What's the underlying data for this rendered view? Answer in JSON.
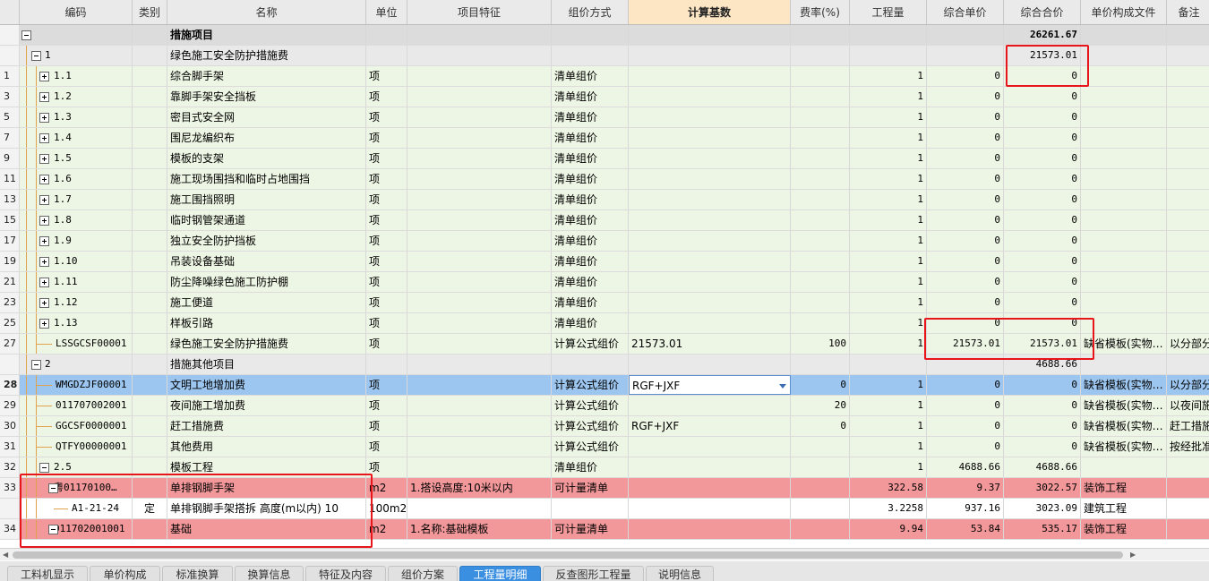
{
  "columns": [
    "",
    "编码",
    "类别",
    "名称",
    "单位",
    "项目特征",
    "组价方式",
    "计算基数",
    "费率(%)",
    "工程量",
    "综合单价",
    "综合合价",
    "单价构成文件",
    "备注"
  ],
  "rows": [
    {
      "kind": "sec",
      "row": "",
      "code": "",
      "type": "",
      "name": "措施项目",
      "unit": "",
      "feature": "",
      "method": "",
      "base": "",
      "rate": "",
      "qty": "",
      "price": "",
      "total": "26261.67",
      "file": "",
      "note": ""
    },
    {
      "kind": "sub",
      "row": "",
      "code": "1",
      "type": "",
      "name": "绿色施工安全防护措施费",
      "unit": "",
      "feature": "",
      "method": "",
      "base": "",
      "rate": "",
      "qty": "",
      "price": "",
      "total": "21573.01",
      "file": "",
      "note": ""
    },
    {
      "kind": "grn",
      "row": "1",
      "code": "1.1",
      "type": "",
      "name": "综合脚手架",
      "unit": "项",
      "feature": "",
      "method": "清单组价",
      "base": "",
      "rate": "",
      "qty": "1",
      "price": "0",
      "total": "0",
      "file": "",
      "note": ""
    },
    {
      "kind": "grn",
      "row": "3",
      "code": "1.2",
      "type": "",
      "name": "靠脚手架安全挡板",
      "unit": "项",
      "feature": "",
      "method": "清单组价",
      "base": "",
      "rate": "",
      "qty": "1",
      "price": "0",
      "total": "0",
      "file": "",
      "note": ""
    },
    {
      "kind": "grn",
      "row": "5",
      "code": "1.3",
      "type": "",
      "name": "密目式安全网",
      "unit": "项",
      "feature": "",
      "method": "清单组价",
      "base": "",
      "rate": "",
      "qty": "1",
      "price": "0",
      "total": "0",
      "file": "",
      "note": ""
    },
    {
      "kind": "grn",
      "row": "7",
      "code": "1.4",
      "type": "",
      "name": "围尼龙编织布",
      "unit": "项",
      "feature": "",
      "method": "清单组价",
      "base": "",
      "rate": "",
      "qty": "1",
      "price": "0",
      "total": "0",
      "file": "",
      "note": ""
    },
    {
      "kind": "grn",
      "row": "9",
      "code": "1.5",
      "type": "",
      "name": "模板的支架",
      "unit": "项",
      "feature": "",
      "method": "清单组价",
      "base": "",
      "rate": "",
      "qty": "1",
      "price": "0",
      "total": "0",
      "file": "",
      "note": ""
    },
    {
      "kind": "grn",
      "row": "11",
      "code": "1.6",
      "type": "",
      "name": "施工现场围挡和临时占地围挡",
      "unit": "项",
      "feature": "",
      "method": "清单组价",
      "base": "",
      "rate": "",
      "qty": "1",
      "price": "0",
      "total": "0",
      "file": "",
      "note": ""
    },
    {
      "kind": "grn",
      "row": "13",
      "code": "1.7",
      "type": "",
      "name": "施工围挡照明",
      "unit": "项",
      "feature": "",
      "method": "清单组价",
      "base": "",
      "rate": "",
      "qty": "1",
      "price": "0",
      "total": "0",
      "file": "",
      "note": ""
    },
    {
      "kind": "grn",
      "row": "15",
      "code": "1.8",
      "type": "",
      "name": "临时钢管架通道",
      "unit": "项",
      "feature": "",
      "method": "清单组价",
      "base": "",
      "rate": "",
      "qty": "1",
      "price": "0",
      "total": "0",
      "file": "",
      "note": ""
    },
    {
      "kind": "grn",
      "row": "17",
      "code": "1.9",
      "type": "",
      "name": "独立安全防护挡板",
      "unit": "项",
      "feature": "",
      "method": "清单组价",
      "base": "",
      "rate": "",
      "qty": "1",
      "price": "0",
      "total": "0",
      "file": "",
      "note": ""
    },
    {
      "kind": "grn",
      "row": "19",
      "code": "1.10",
      "type": "",
      "name": "吊装设备基础",
      "unit": "项",
      "feature": "",
      "method": "清单组价",
      "base": "",
      "rate": "",
      "qty": "1",
      "price": "0",
      "total": "0",
      "file": "",
      "note": ""
    },
    {
      "kind": "grn",
      "row": "21",
      "code": "1.11",
      "type": "",
      "name": "防尘降噪绿色施工防护棚",
      "unit": "项",
      "feature": "",
      "method": "清单组价",
      "base": "",
      "rate": "",
      "qty": "1",
      "price": "0",
      "total": "0",
      "file": "",
      "note": ""
    },
    {
      "kind": "grn",
      "row": "23",
      "code": "1.12",
      "type": "",
      "name": "施工便道",
      "unit": "项",
      "feature": "",
      "method": "清单组价",
      "base": "",
      "rate": "",
      "qty": "1",
      "price": "0",
      "total": "0",
      "file": "",
      "note": ""
    },
    {
      "kind": "grn",
      "row": "25",
      "code": "1.13",
      "type": "",
      "name": "样板引路",
      "unit": "项",
      "feature": "",
      "method": "清单组价",
      "base": "",
      "rate": "",
      "qty": "1",
      "price": "0",
      "total": "0",
      "file": "",
      "note": ""
    },
    {
      "kind": "grn",
      "row": "27",
      "code": "LSSGCSF00001",
      "type": "",
      "name": "绿色施工安全防护措施费",
      "unit": "项",
      "feature": "",
      "method": "计算公式组价",
      "base": "21573.01",
      "rate": "100",
      "qty": "1",
      "price": "21573.01",
      "total": "21573.01",
      "file": "缺省模板(实物…",
      "note": "以分部分"
    },
    {
      "kind": "sub",
      "row": "",
      "code": "2",
      "type": "",
      "name": "措施其他项目",
      "unit": "",
      "feature": "",
      "method": "",
      "base": "",
      "rate": "",
      "qty": "",
      "price": "",
      "total": "4688.66",
      "file": "",
      "note": ""
    },
    {
      "kind": "sel",
      "row": "28",
      "code": "WMGDZJF00001",
      "type": "",
      "name": "文明工地增加费",
      "unit": "项",
      "feature": "",
      "method": "计算公式组价",
      "base": "RGF+JXF",
      "rate": "0",
      "qty": "1",
      "price": "0",
      "total": "0",
      "file": "缺省模板(实物…",
      "note": "以分部分"
    },
    {
      "kind": "grn",
      "row": "29",
      "code": "011707002001",
      "type": "",
      "name": "夜间施工增加费",
      "unit": "项",
      "feature": "",
      "method": "计算公式组价",
      "base": "",
      "rate": "20",
      "qty": "1",
      "price": "0",
      "total": "0",
      "file": "缺省模板(实物…",
      "note": "以夜间施"
    },
    {
      "kind": "grn",
      "row": "30",
      "code": "GGCSF0000001",
      "type": "",
      "name": "赶工措施费",
      "unit": "项",
      "feature": "",
      "method": "计算公式组价",
      "base": "RGF+JXF",
      "rate": "0",
      "qty": "1",
      "price": "0",
      "total": "0",
      "file": "缺省模板(实物…",
      "note": "赶工措施"
    },
    {
      "kind": "grn",
      "row": "31",
      "code": "QTFY00000001",
      "type": "",
      "name": "其他费用",
      "unit": "项",
      "feature": "",
      "method": "计算公式组价",
      "base": "",
      "rate": "",
      "qty": "1",
      "price": "0",
      "total": "0",
      "file": "缺省模板(实物…",
      "note": "按经批准"
    },
    {
      "kind": "grn",
      "row": "32",
      "code": "2.5",
      "type": "",
      "name": "模板工程",
      "unit": "项",
      "feature": "",
      "method": "清单组价",
      "base": "",
      "rate": "",
      "qty": "1",
      "price": "4688.66",
      "total": "4688.66",
      "file": "",
      "note": ""
    },
    {
      "kind": "red",
      "row": "33",
      "code": "粤01170100…",
      "type": "",
      "name": "单排钢脚手架",
      "unit": "m2",
      "feature": "1.搭设高度:10米以内",
      "method": "可计量清单",
      "base": "",
      "rate": "",
      "qty": "322.58",
      "price": "9.37",
      "total": "3022.57",
      "file": "装饰工程",
      "note": ""
    },
    {
      "kind": "wht",
      "row": "",
      "code": "A1-21-24",
      "type": "定",
      "name": "单排钢脚手架搭拆 高度(m以内) 10",
      "unit": "100m2",
      "feature": "",
      "method": "",
      "base": "",
      "rate": "",
      "qty": "3.2258",
      "price": "937.16",
      "total": "3023.09",
      "file": "建筑工程",
      "note": ""
    },
    {
      "kind": "red",
      "row": "34",
      "code": "011702001001",
      "type": "",
      "name": "基础",
      "unit": "m2",
      "feature": "1.名称:基础模板",
      "method": "可计量清单",
      "base": "",
      "rate": "",
      "qty": "9.94",
      "price": "53.84",
      "total": "535.17",
      "file": "装饰工程",
      "note": ""
    }
  ],
  "tabs": [
    "工料机显示",
    "单价构成",
    "标准换算",
    "换算信息",
    "特征及内容",
    "组价方案",
    "工程量明细",
    "反查图形工程量",
    "说明信息"
  ],
  "active_tab": "工程量明细",
  "active_column": "计算基数",
  "colors": {
    "green_row": "#edf6e4",
    "selected_row": "#9cc6ef",
    "red_row": "#f2989a",
    "highlight_box": "#e8151b",
    "active_tab": "#3b8fe0"
  }
}
